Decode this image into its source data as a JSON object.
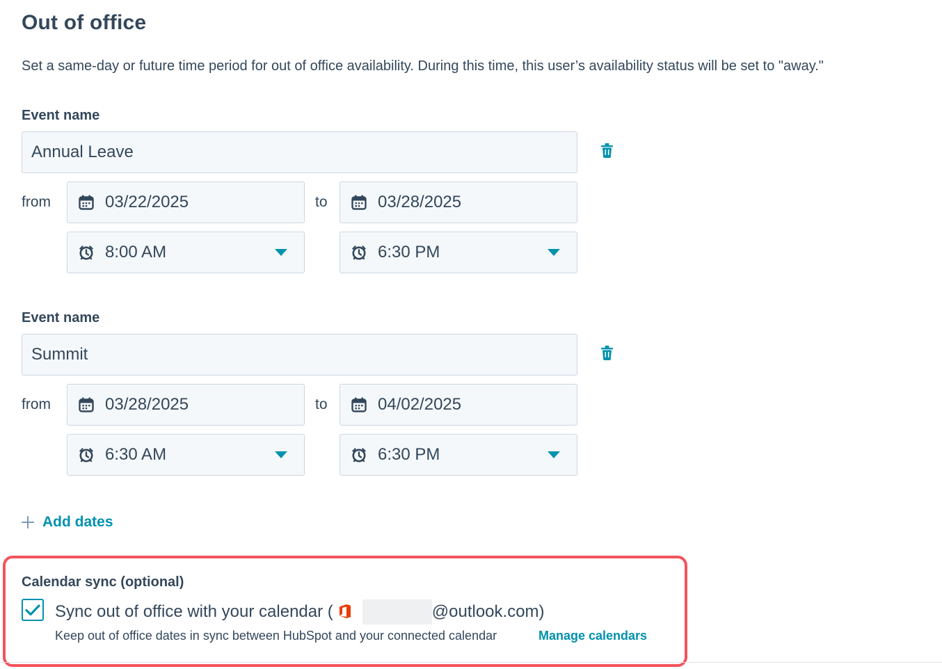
{
  "page": {
    "title": "Out of office",
    "description": "Set a same-day or future time period for out of office availability. During this time, this user’s availability status will be set to \"away.\""
  },
  "events": [
    {
      "name_label": "Event name",
      "name": "Annual Leave",
      "from_label": "from",
      "to_label": "to",
      "start_date": "03/22/2025",
      "end_date": "03/28/2025",
      "start_time": "8:00 AM",
      "end_time": "6:30 PM"
    },
    {
      "name_label": "Event name",
      "name": "Summit",
      "from_label": "from",
      "to_label": "to",
      "start_date": "03/28/2025",
      "end_date": "04/02/2025",
      "start_time": "6:30 AM",
      "end_time": "6:30 PM"
    }
  ],
  "add_dates": {
    "label": "Add dates",
    "icon": "plus-icon"
  },
  "calendar_sync": {
    "title": "Calendar sync (optional)",
    "checked": true,
    "label_prefix": "Sync out of office with your calendar (",
    "email_suffix": "@outlook.com)",
    "provider_icon": "office-icon",
    "help_text": "Keep out of office dates in sync between HubSpot and your connected calendar",
    "manage_link": "Manage calendars"
  },
  "colors": {
    "text": "#33475b",
    "accent": "#0091ae",
    "field_bg": "#f5f8fa",
    "field_border": "#cbd6e2",
    "highlight": "#f2545b",
    "office": "#eb3c00"
  },
  "icons": {
    "calendar": "calendar-icon",
    "clock": "alarm-clock-icon",
    "trash": "trash-icon",
    "dropdown": "caret-down-icon",
    "checkbox": "check-icon"
  }
}
